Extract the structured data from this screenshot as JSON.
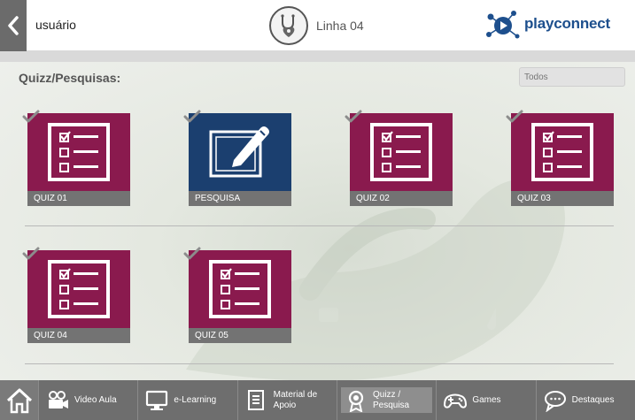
{
  "header": {
    "username": "usuário",
    "line_title": "Linha 04",
    "brand_name": "playconnect"
  },
  "main": {
    "section_title": "Quizz/Pesquisas:",
    "filter_placeholder": "Todos",
    "tiles": [
      {
        "label": "QUIZ 01",
        "type": "quiz",
        "completed": true
      },
      {
        "label": "PESQUISA",
        "type": "survey",
        "completed": true
      },
      {
        "label": "QUIZ 02",
        "type": "quiz",
        "completed": true
      },
      {
        "label": "QUIZ 03",
        "type": "quiz",
        "completed": true
      },
      {
        "label": "QUIZ 04",
        "type": "quiz",
        "completed": true
      },
      {
        "label": "QUIZ 05",
        "type": "quiz",
        "completed": true
      }
    ]
  },
  "nav": {
    "items": [
      {
        "label": "Video Aula",
        "icon": "camera-icon"
      },
      {
        "label": "e-Learning",
        "icon": "monitor-icon"
      },
      {
        "label": "Material de Apoio",
        "icon": "document-icon"
      },
      {
        "label": "Quizz / Pesquisa",
        "icon": "award-icon",
        "active": true
      },
      {
        "label": "Games",
        "icon": "gamepad-icon"
      },
      {
        "label": "Destaques",
        "icon": "chat-bubble-icon"
      }
    ]
  },
  "colors": {
    "quiz_tile": "#8a1a4e",
    "survey_tile": "#1b3f6f",
    "nav_bar": "#6e6e6e",
    "brand": "#1d4f8d"
  }
}
